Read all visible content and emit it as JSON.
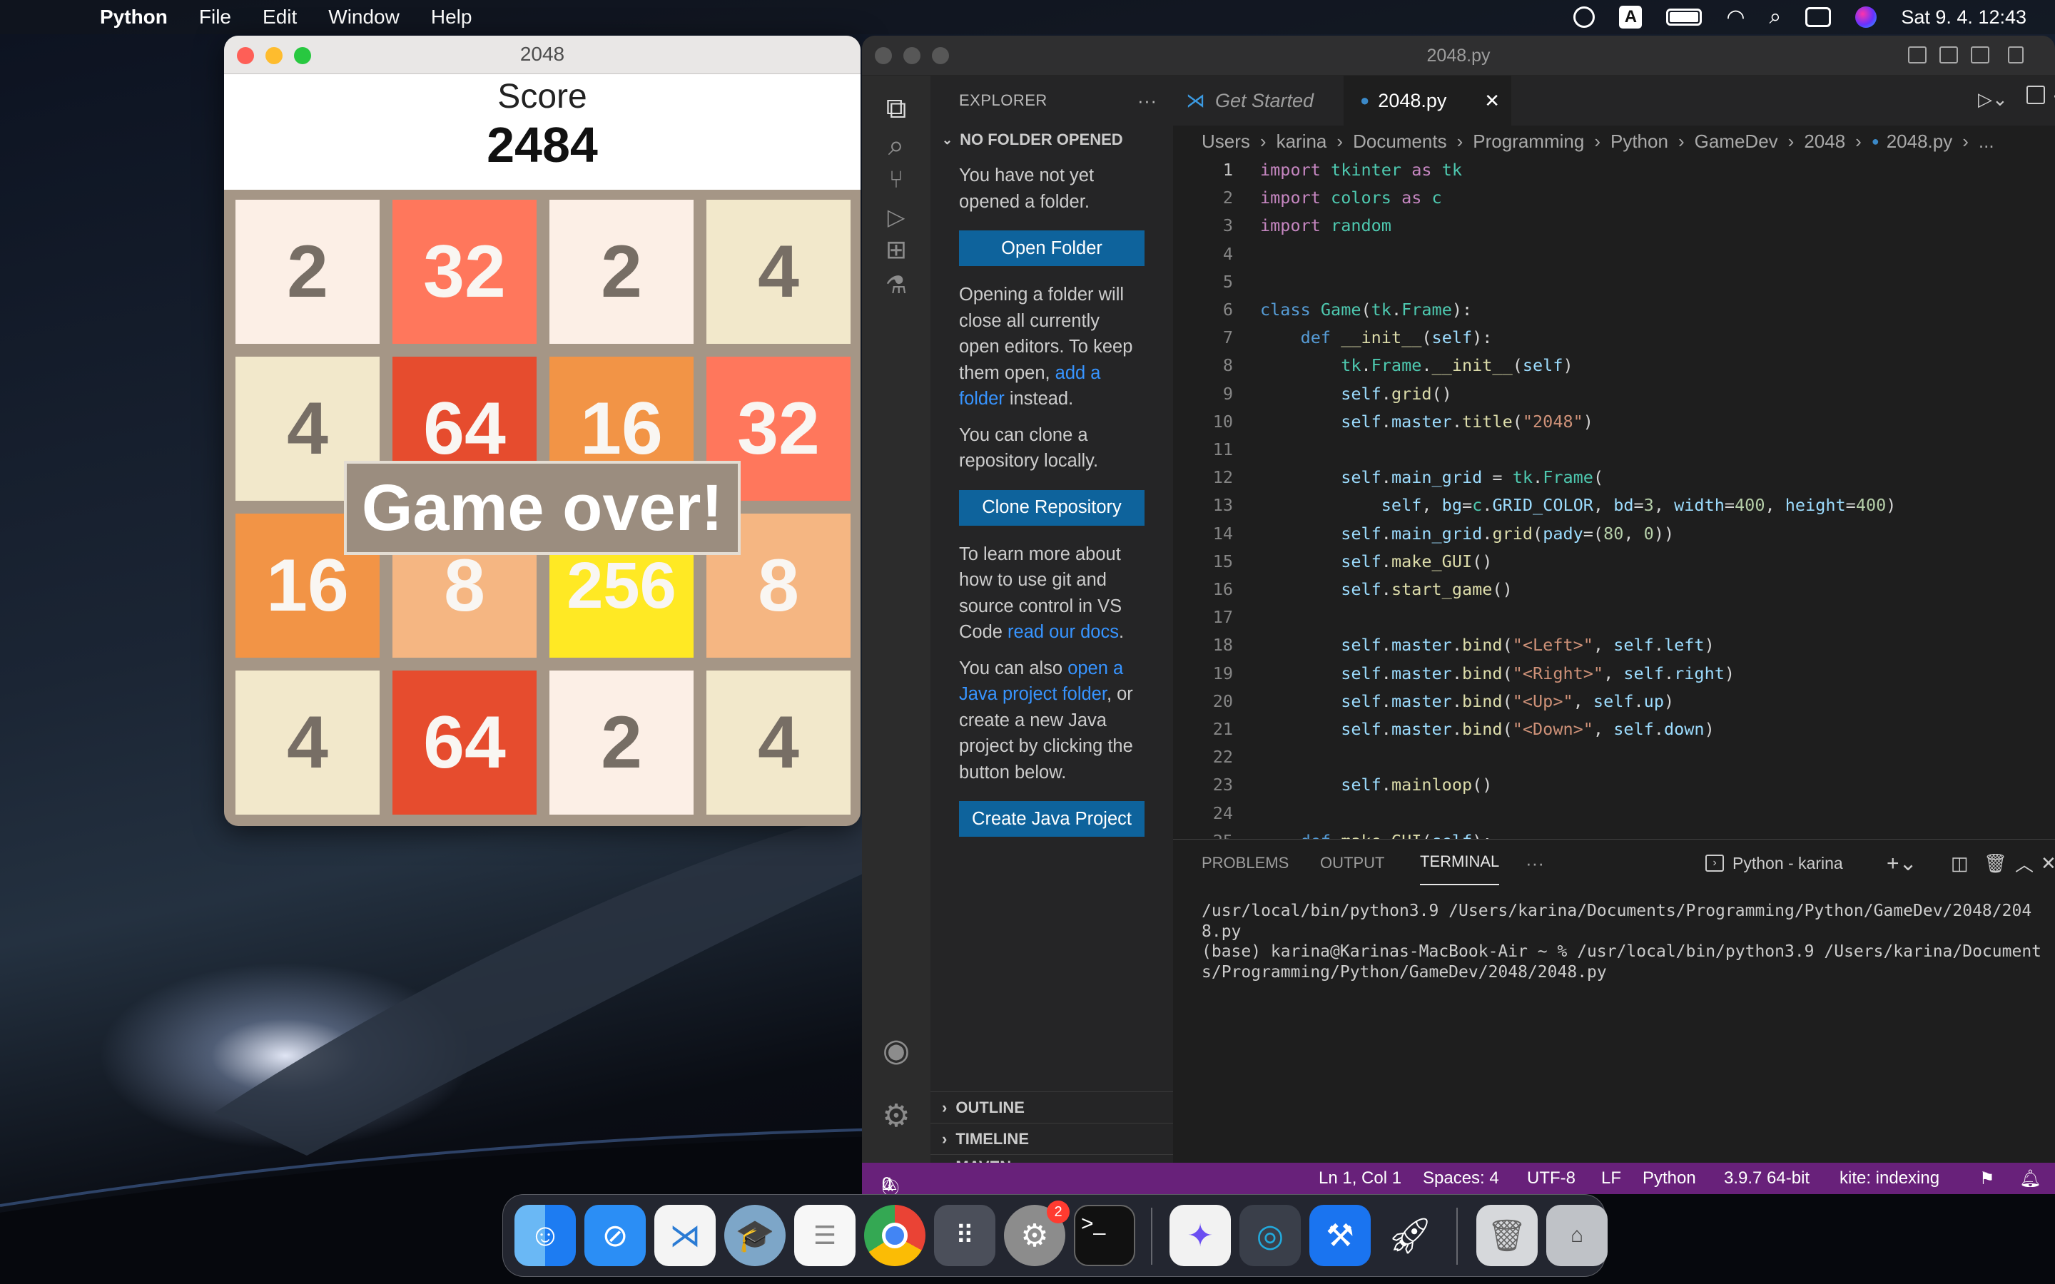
{
  "menubar": {
    "app_name": "Python",
    "menus": [
      "File",
      "Edit",
      "Window",
      "Help"
    ],
    "clock": "Sat 9. 4.  12:43",
    "input_source": "A"
  },
  "game": {
    "window_title": "2048",
    "score_label": "Score",
    "score": "2484",
    "overlay": "Game over!",
    "rows": [
      [
        "2",
        "32",
        "2",
        "4"
      ],
      [
        "4",
        "64",
        "16",
        "32"
      ],
      [
        "16",
        "8",
        "256",
        "8"
      ],
      [
        "4",
        "64",
        "2",
        "4"
      ]
    ],
    "tile_colors": {
      "2": {
        "bg": "#fcefe6",
        "fg": "#776e65"
      },
      "4": {
        "bg": "#f2e8cb",
        "fg": "#776e65"
      },
      "8": {
        "bg": "#f5b682",
        "fg": "#f9f6f2"
      },
      "16": {
        "bg": "#f29446",
        "fg": "#f9f6f2"
      },
      "32": {
        "bg": "#ff775c",
        "fg": "#f9f6f2"
      },
      "64": {
        "bg": "#e64c2e",
        "fg": "#f9f6f2"
      },
      "256": {
        "bg": "#ffe924",
        "fg": "#f9f6f2"
      }
    }
  },
  "vscode": {
    "window_title": "2048.py",
    "explorer": {
      "title": "EXPLORER",
      "section": "NO FOLDER OPENED",
      "msg1": "You have not yet opened a folder.",
      "open_folder_btn": "Open Folder",
      "msg2_a": "Opening a folder will close all currently open editors. To keep them open, ",
      "msg2_link": "add a folder",
      "msg2_b": " instead.",
      "msg3": "You can clone a repository locally.",
      "clone_btn": "Clone Repository",
      "msg4_a": "To learn more about how to use git and source control in VS Code ",
      "msg4_link": "read our docs",
      "msg4_b": ".",
      "msg5_a": "You can also ",
      "msg5_link": "open a Java project folder",
      "msg5_b": ", or create a new Java project by clicking the button below.",
      "java_btn": "Create Java Project",
      "outline": "OUTLINE",
      "timeline": "TIMELINE",
      "maven": "MAVEN"
    },
    "tabs": [
      "Get Started",
      "2048.py"
    ],
    "breadcrumb": [
      "Users",
      "karina",
      "Documents",
      "Programming",
      "Python",
      "GameDev",
      "2048",
      "2048.py",
      "..."
    ],
    "panel_tabs": [
      "PROBLEMS",
      "OUTPUT",
      "TERMINAL"
    ],
    "terminal_profile": "Python - karina",
    "terminal_lines": [
      "/usr/local/bin/python3.9 /Users/karina/Documents/Programming/Python/GameDev/2048/2048.py",
      "(base) karina@Karinas-MacBook-Air ~ % /usr/local/bin/python3.9 /Users/karina/Documents/Programming/Python/GameDev/2048/2048.py"
    ],
    "status": {
      "errors": "0",
      "warnings": "0",
      "position": "Ln 1, Col 1",
      "spaces": "Spaces: 4",
      "encoding": "UTF-8",
      "eol": "LF",
      "language": "Python",
      "interpreter": "3.9.7 64-bit",
      "kite": "kite: indexing"
    }
  },
  "dock": {
    "settings_badge": "2"
  }
}
